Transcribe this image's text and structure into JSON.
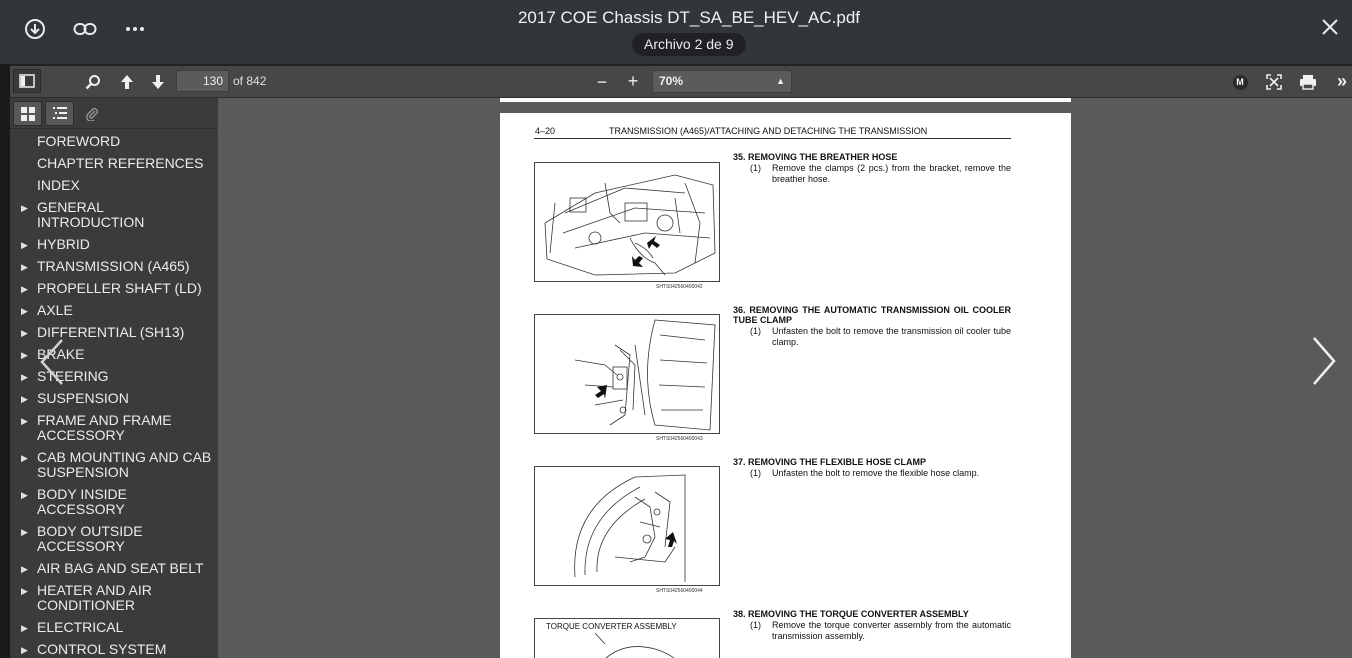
{
  "window": {
    "title": "2017 COE Chassis DT_SA_BE_HEV_AC.pdf",
    "file_counter": "Archivo 2 de 9"
  },
  "toolbar": {
    "page_current": "130",
    "page_total": "of 842",
    "zoom": "70%",
    "minus": "−",
    "plus": "+",
    "more": "»",
    "mode_letter": "M"
  },
  "outline": [
    {
      "label": "FOREWORD",
      "expandable": false
    },
    {
      "label": "CHAPTER REFERENCES",
      "expandable": false
    },
    {
      "label": "INDEX",
      "expandable": false
    },
    {
      "label": "GENERAL INTRODUCTION",
      "expandable": true
    },
    {
      "label": "HYBRID",
      "expandable": true
    },
    {
      "label": "TRANSMISSION (A465)",
      "expandable": true
    },
    {
      "label": "PROPELLER SHAFT (LD)",
      "expandable": true
    },
    {
      "label": "AXLE",
      "expandable": true
    },
    {
      "label": "DIFFERENTIAL (SH13)",
      "expandable": true
    },
    {
      "label": "BRAKE",
      "expandable": true
    },
    {
      "label": "STEERING",
      "expandable": true
    },
    {
      "label": "SUSPENSION",
      "expandable": true
    },
    {
      "label": "FRAME AND FRAME ACCESSORY",
      "expandable": true
    },
    {
      "label": "CAB MOUNTING AND CAB SUSPENSION",
      "expandable": true
    },
    {
      "label": "BODY INSIDE ACCESSORY",
      "expandable": true
    },
    {
      "label": "BODY OUTSIDE ACCESSORY",
      "expandable": true
    },
    {
      "label": "AIR BAG AND SEAT BELT",
      "expandable": true
    },
    {
      "label": "HEATER AND AIR CONDITIONER",
      "expandable": true
    },
    {
      "label": "ELECTRICAL",
      "expandable": true
    },
    {
      "label": "CONTROL SYSTEM",
      "expandable": true
    }
  ],
  "pdf_page": {
    "page_number": "4–20",
    "header_title": "TRANSMISSION (A465)/ATTACHING AND DETACHING THE TRANSMISSION",
    "steps": [
      {
        "title": "35.  REMOVING THE BREATHER HOSE",
        "num": "(1)",
        "text": "Remove the clamps (2 pcs.) from the bracket, remove the breather hose.",
        "fig_code": "SHTS042560400042"
      },
      {
        "title": "36.  REMOVING THE AUTOMATIC TRANSMISSION OIL COOLER TUBE CLAMP",
        "num": "(1)",
        "text": "Unfasten the bolt to remove the transmission oil cooler tube clamp.",
        "fig_code": "SHTS042560400043"
      },
      {
        "title": "37.  REMOVING THE FLEXIBLE HOSE CLAMP",
        "num": "(1)",
        "text": "Unfasten the bolt to remove the flexible hose clamp.",
        "fig_code": "SHTS042560400044"
      },
      {
        "title": "38.  REMOVING THE TORQUE CONVERTER ASSEMBLY",
        "num": "(1)",
        "text": "Remove the torque converter assembly from the automatic transmission assembly.",
        "fig_label": "TORQUE CONVERTER ASSEMBLY"
      }
    ]
  },
  "icons": {
    "download": "download-icon",
    "link": "link-icon",
    "more": "more-icon",
    "close": "close-icon",
    "sidebar": "sidebar-toggle-icon",
    "search": "search-icon",
    "up": "arrow-up-icon",
    "down": "arrow-down-icon",
    "fullscreen": "fullscreen-icon",
    "print": "print-icon",
    "thumbnails": "thumbnails-icon",
    "outline": "outline-icon",
    "attachments": "paperclip-icon",
    "prev": "chevron-left-icon",
    "next": "chevron-right-icon"
  },
  "colors": {
    "topbar": "#323639",
    "toolbar": "#474747",
    "sidebar": "#3b3b3b",
    "viewer": "#5a5a5a"
  }
}
